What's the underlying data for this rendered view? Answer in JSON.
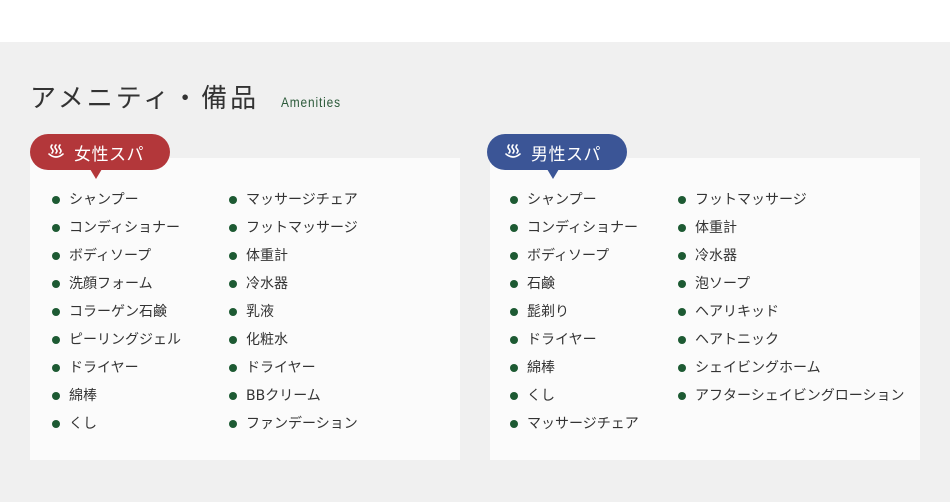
{
  "heading": {
    "title_jp": "アメニティ・備品",
    "title_en": "Amenities"
  },
  "colors": {
    "female_tab": "#b3373a",
    "male_tab": "#3b5596",
    "bullet": "#1d5a33",
    "accent_text": "#2c5a3a"
  },
  "female": {
    "tab_label": "女性スパ",
    "tab_icon": "hot-spring-icon",
    "col1": [
      "シャンプー",
      "コンディショナー",
      "ボディソープ",
      "洗顔フォーム",
      "コラーゲン石鹸",
      "ピーリングジェル",
      "ドライヤー",
      "綿棒",
      "くし"
    ],
    "col2": [
      "マッサージチェア",
      "フットマッサージ",
      "体重計",
      "冷水器",
      "乳液",
      "化粧水",
      "ドライヤー",
      "BBクリーム",
      "ファンデーション"
    ]
  },
  "male": {
    "tab_label": "男性スパ",
    "tab_icon": "hot-spring-icon",
    "col1": [
      "シャンプー",
      "コンディショナー",
      "ボディソープ",
      "石鹸",
      "髭剃り",
      "ドライヤー",
      "綿棒",
      "くし",
      "マッサージチェア"
    ],
    "col2": [
      "フットマッサージ",
      "体重計",
      "冷水器",
      "泡ソープ",
      "ヘアリキッド",
      "ヘアトニック",
      "シェイビングホーム",
      "アフターシェイビングローション"
    ]
  }
}
